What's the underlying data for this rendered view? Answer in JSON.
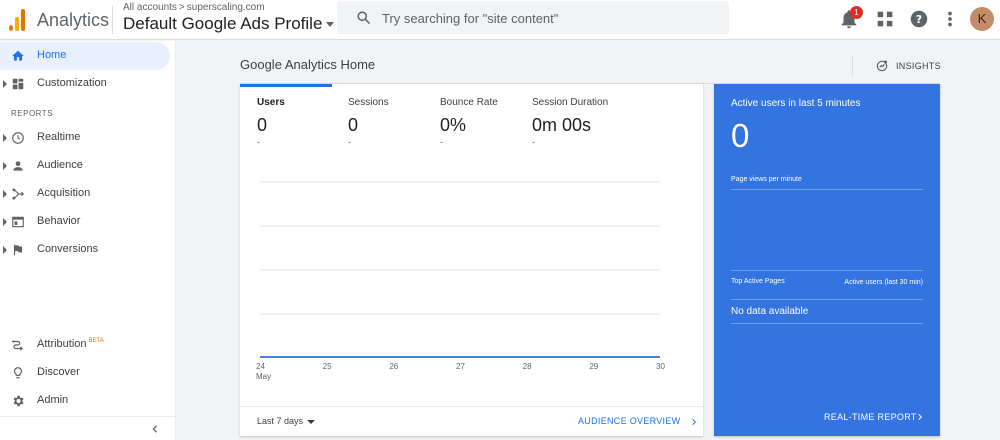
{
  "header": {
    "app_name": "Analytics",
    "breadcrumb_root": "All accounts",
    "breadcrumb_separator": ">",
    "breadcrumb_account": "superscaling.com",
    "profile_name": "Default Google Ads Profile",
    "search_placeholder": "Try searching for \"site content\"",
    "notification_count": "1",
    "avatar_initial": "K"
  },
  "sidebar": {
    "items": [
      {
        "label": "Home",
        "icon": "home-icon"
      },
      {
        "label": "Customization",
        "icon": "dashboard-icon"
      }
    ],
    "section_label": "REPORTS",
    "reports": [
      {
        "label": "Realtime",
        "icon": "clock-icon"
      },
      {
        "label": "Audience",
        "icon": "person-icon"
      },
      {
        "label": "Acquisition",
        "icon": "acquisition-icon"
      },
      {
        "label": "Behavior",
        "icon": "behavior-icon"
      },
      {
        "label": "Conversions",
        "icon": "flag-icon"
      }
    ],
    "bottom": [
      {
        "label": "Attribution",
        "icon": "attribution-icon",
        "badge": "BETA"
      },
      {
        "label": "Discover",
        "icon": "lightbulb-icon"
      },
      {
        "label": "Admin",
        "icon": "gear-icon"
      }
    ]
  },
  "main": {
    "title": "Google Analytics Home",
    "insights_label": "INSIGHTS",
    "metrics": [
      {
        "label": "Users",
        "value": "0",
        "sub": "-"
      },
      {
        "label": "Sessions",
        "value": "0",
        "sub": "-"
      },
      {
        "label": "Bounce Rate",
        "value": "0%",
        "sub": "-"
      },
      {
        "label": "Session Duration",
        "value": "0m 00s",
        "sub": "-"
      }
    ],
    "date_range": "Last 7 days",
    "audience_link": "AUDIENCE OVERVIEW"
  },
  "chart_data": {
    "type": "line",
    "x": [
      "24",
      "25",
      "26",
      "27",
      "28",
      "29",
      "30"
    ],
    "x_month_label": "May",
    "series": [
      {
        "values": [
          0,
          0,
          0,
          0,
          0,
          0,
          0
        ]
      }
    ],
    "grid": true,
    "accent": "#4a7fdc"
  },
  "realtime": {
    "title": "Active users in last 5 minutes",
    "count": "0",
    "page_views_label": "Page views per minute",
    "col_pages": "Top Active Pages",
    "col_users": "Active users (last 30 min)",
    "no_data": "No data available",
    "report_link": "REAL-TIME REPORT",
    "background": "#3374e0"
  }
}
